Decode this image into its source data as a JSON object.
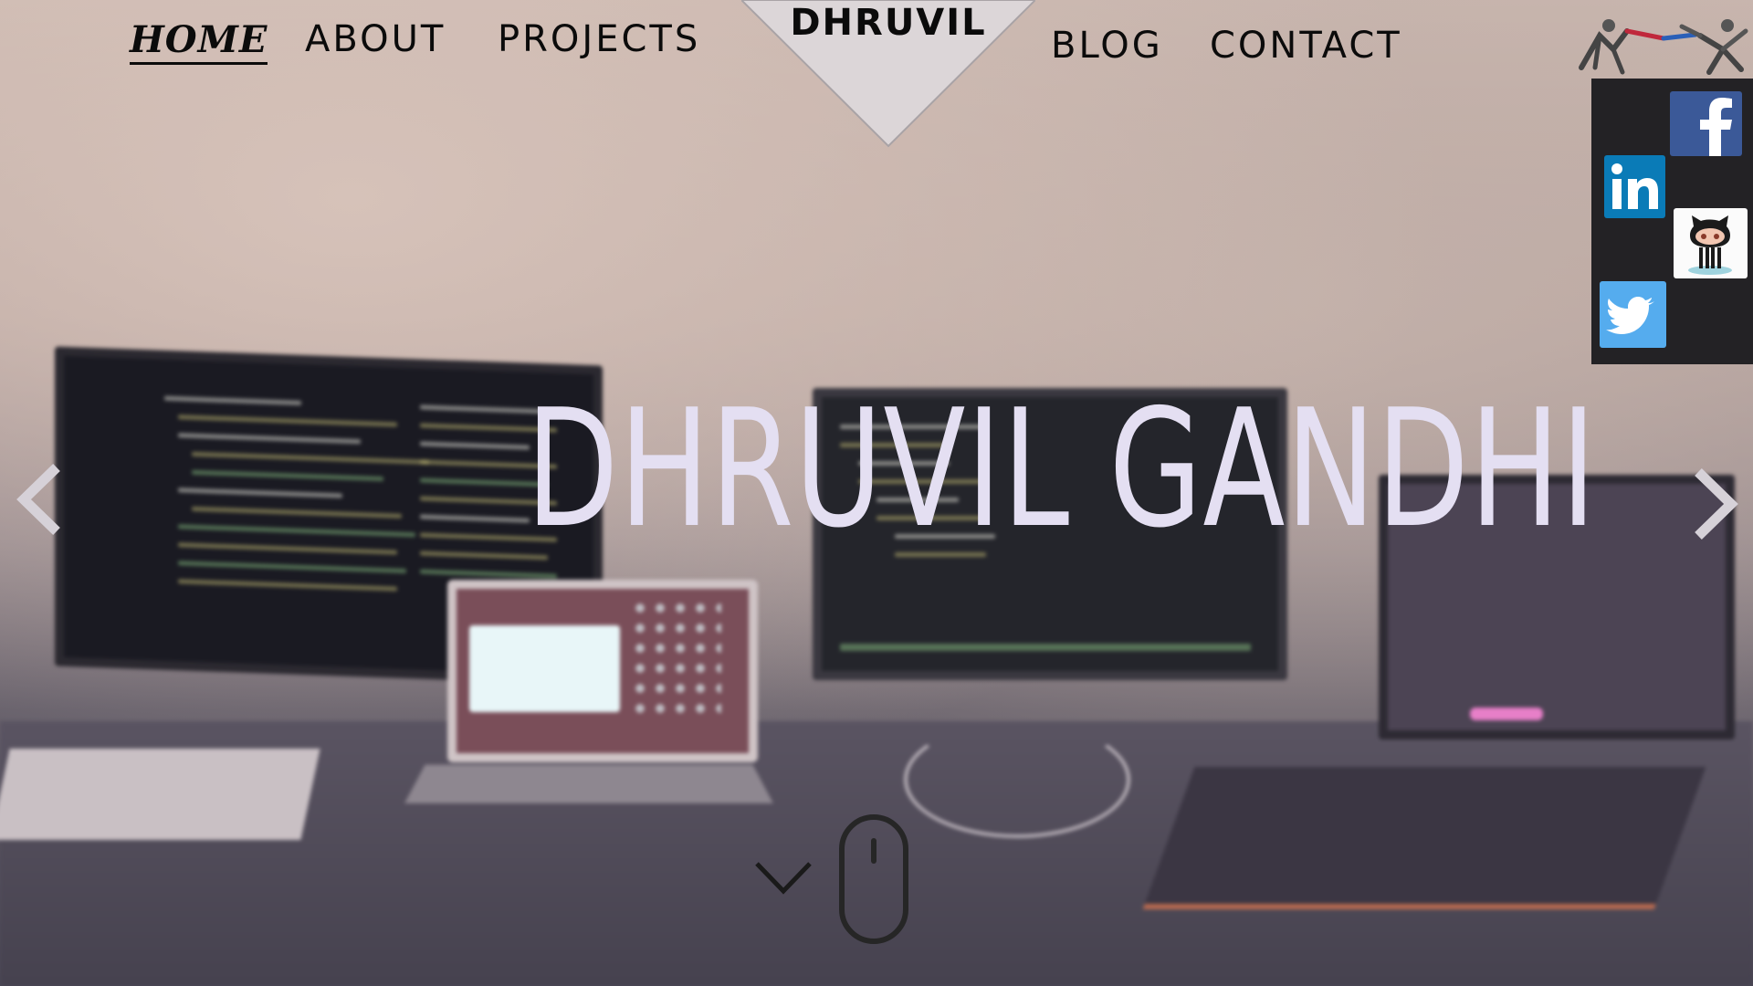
{
  "nav": {
    "home": "HOME",
    "about": "ABOUT",
    "projects": "PROJECTS",
    "blog": "BLOG",
    "contact": "CONTACT",
    "active": "home"
  },
  "logo": {
    "text": "DHRUVIL"
  },
  "hero": {
    "title": "DHRUVIL GANDHI"
  },
  "social": {
    "items": [
      {
        "name": "facebook",
        "icon": "facebook-icon",
        "color": "#3b5998"
      },
      {
        "name": "linkedin",
        "icon": "linkedin-icon",
        "color": "#0a7bb7"
      },
      {
        "name": "github",
        "icon": "github-octocat-icon",
        "color": "#fbfbfb"
      },
      {
        "name": "twitter",
        "icon": "twitter-bird-icon",
        "color": "#55acee"
      }
    ],
    "panel_color": "#232225"
  },
  "carousel": {
    "prev_icon": "chevron-left-icon",
    "next_icon": "chevron-right-icon"
  },
  "scroll_hint": {
    "chevron_icon": "chevron-down-icon",
    "mouse_icon": "mouse-icon"
  },
  "colors": {
    "hero_text": "#e4dff2",
    "nav_text": "#0b0b0b",
    "logo_fill": "#dcd6d8"
  }
}
